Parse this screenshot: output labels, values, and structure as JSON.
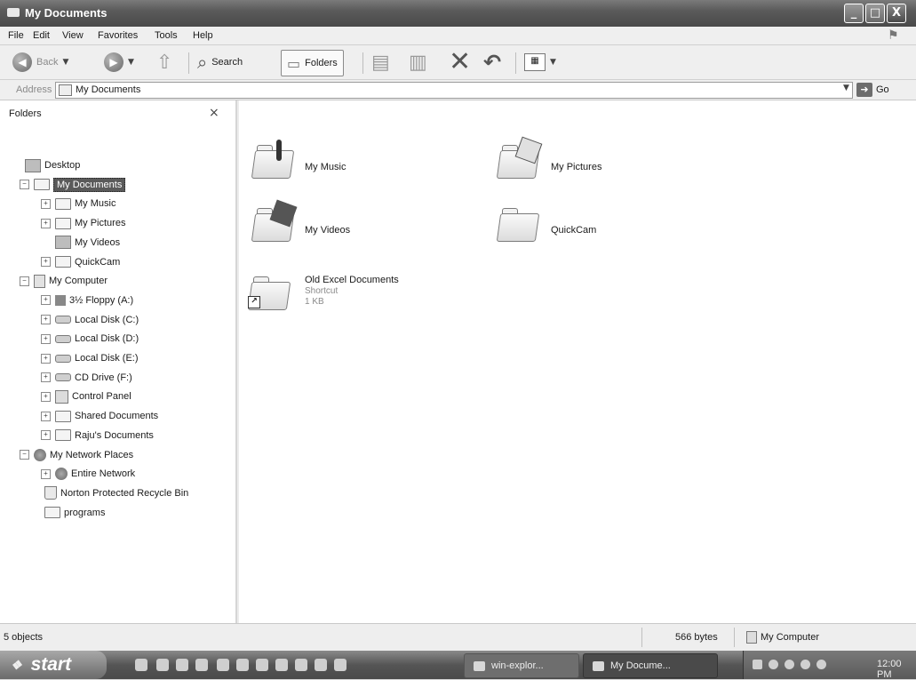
{
  "window": {
    "title": "My Documents",
    "buttons": {
      "minimize": "_",
      "maximize": "□",
      "close": "X"
    }
  },
  "menu": [
    "File",
    "Edit",
    "View",
    "Favorites",
    "Tools",
    "Help"
  ],
  "toolbar": {
    "back": "Back",
    "search": "Search",
    "folders": "Folders"
  },
  "address": {
    "label": "Address",
    "value": "My Documents",
    "go": "Go"
  },
  "folders_pane": {
    "title": "Folders",
    "close": "×",
    "tree": [
      {
        "label": "Desktop",
        "icon": "desktop-icon",
        "expander": ""
      },
      {
        "label": "My Documents",
        "icon": "my-documents-icon",
        "expander": "−",
        "selected": true
      },
      {
        "label": "My Music",
        "icon": "my-music-icon",
        "expander": "+"
      },
      {
        "label": "My Pictures",
        "icon": "my-pictures-icon",
        "expander": "+"
      },
      {
        "label": "My Videos",
        "icon": "my-videos-icon",
        "expander": ""
      },
      {
        "label": "QuickCam",
        "icon": "folder-icon",
        "expander": "+"
      },
      {
        "label": "My Computer",
        "icon": "my-computer-icon",
        "expander": "−"
      },
      {
        "label": "3½ Floppy (A:)",
        "icon": "floppy-icon",
        "expander": "+"
      },
      {
        "label": "Local Disk (C:)",
        "icon": "drive-icon",
        "expander": "+"
      },
      {
        "label": "Local Disk (D:)",
        "icon": "drive-icon",
        "expander": "+"
      },
      {
        "label": "Local Disk (E:)",
        "icon": "drive-icon",
        "expander": "+"
      },
      {
        "label": "CD Drive (F:)",
        "icon": "cd-drive-icon",
        "expander": "+"
      },
      {
        "label": "Control Panel",
        "icon": "control-panel-icon",
        "expander": "+"
      },
      {
        "label": "Shared Documents",
        "icon": "folder-icon",
        "expander": "+"
      },
      {
        "label": "Raju's Documents",
        "icon": "folder-icon",
        "expander": "+"
      },
      {
        "label": "My Network Places",
        "icon": "network-places-icon",
        "expander": "−"
      },
      {
        "label": "Entire Network",
        "icon": "entire-network-icon",
        "expander": "+"
      },
      {
        "label": "Norton Protected Recycle Bin",
        "icon": "recycle-bin-icon",
        "expander": ""
      },
      {
        "label": "programs",
        "icon": "folder-icon",
        "expander": ""
      }
    ]
  },
  "content": {
    "items": [
      {
        "name": "My Music",
        "icon": "music-folder-icon"
      },
      {
        "name": "My Pictures",
        "icon": "pictures-folder-icon"
      },
      {
        "name": "My Videos",
        "icon": "videos-folder-icon"
      },
      {
        "name": "QuickCam",
        "icon": "folder-icon"
      },
      {
        "name": "Old Excel Documents",
        "icon": "shortcut-folder-icon",
        "type": "Shortcut",
        "size": "1 KB"
      }
    ]
  },
  "status": {
    "objects": "5 objects",
    "size": "566 bytes",
    "location": "My Computer"
  },
  "taskbar": {
    "start": "start",
    "tasks": [
      "win-explor...",
      "My Docume..."
    ],
    "clock": "12:00 PM"
  }
}
